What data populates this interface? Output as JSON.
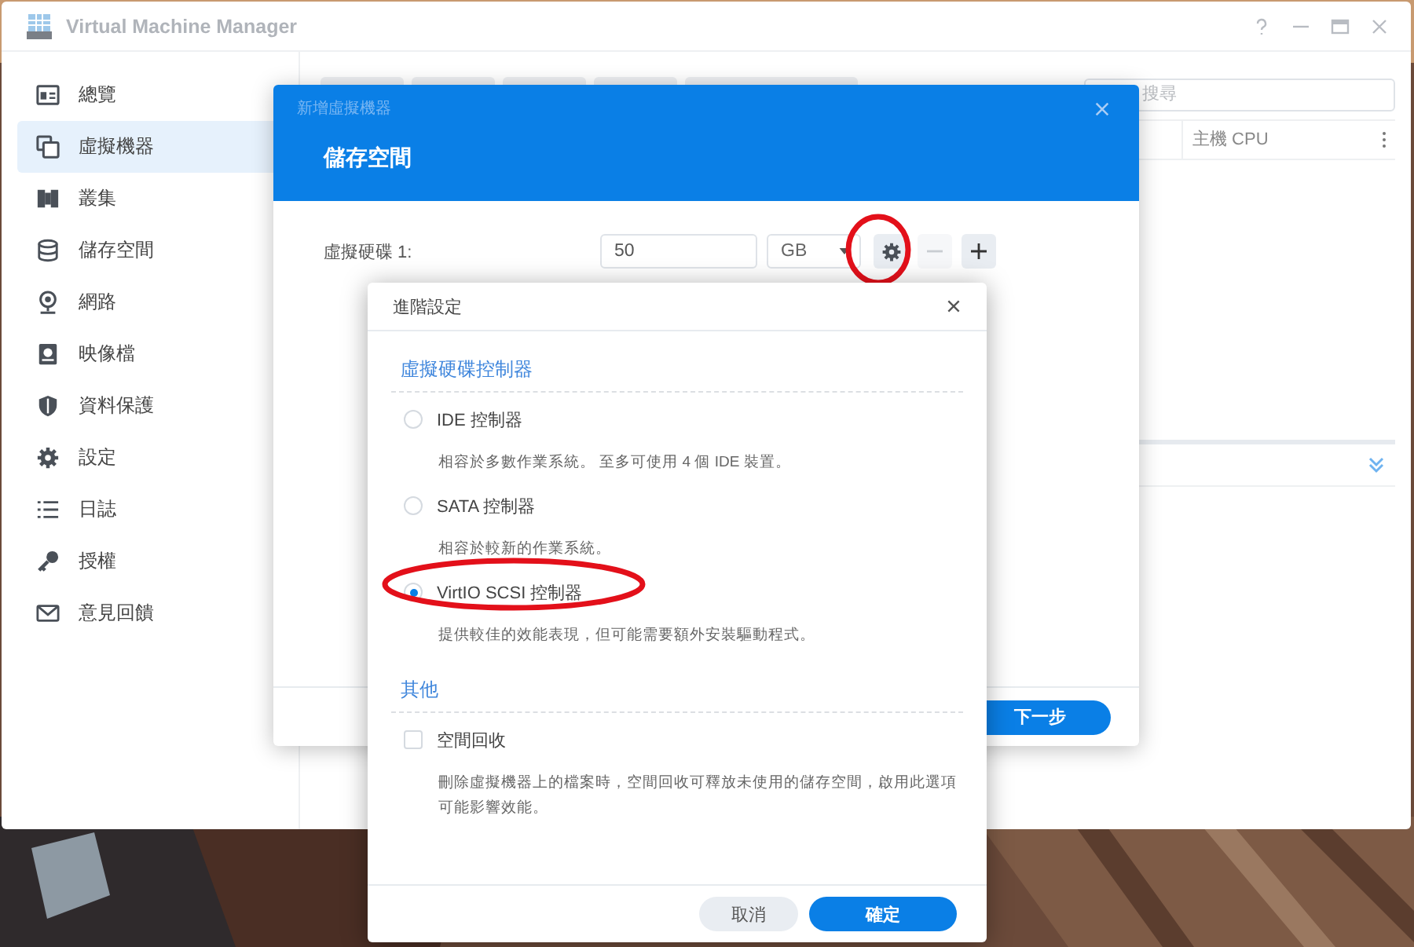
{
  "window": {
    "title": "Virtual Machine Manager"
  },
  "sidebar": {
    "items": [
      {
        "label": "總覽",
        "selected": false
      },
      {
        "label": "虛擬機器",
        "selected": true
      },
      {
        "label": "叢集",
        "selected": false
      },
      {
        "label": "儲存空間",
        "selected": false
      },
      {
        "label": "網路",
        "selected": false
      },
      {
        "label": "映像檔",
        "selected": false
      },
      {
        "label": "資料保護",
        "selected": false
      },
      {
        "label": "設定",
        "selected": false
      },
      {
        "label": "日誌",
        "selected": false
      },
      {
        "label": "授權",
        "selected": false
      },
      {
        "label": "意見回饋",
        "selected": false
      }
    ]
  },
  "search": {
    "placeholder": "搜尋"
  },
  "table": {
    "columns": [
      "主機 CPU"
    ]
  },
  "wizard": {
    "subtitle": "新增虛擬機器",
    "title": "儲存空間",
    "disk": {
      "label": "虛擬硬碟 1:",
      "size": "50",
      "unit": "GB",
      "remove_disabled": true
    },
    "next_button": "下一步"
  },
  "advanced": {
    "title": "進階設定",
    "sections": [
      {
        "heading": "虛擬硬碟控制器",
        "options": [
          {
            "kind": "radio",
            "label": "IDE 控制器",
            "description": "相容於多數作業系統。 至多可使用 4 個 IDE 裝置。",
            "selected": false
          },
          {
            "kind": "radio",
            "label": "SATA 控制器",
            "description": "相容於較新的作業系統。",
            "selected": false
          },
          {
            "kind": "radio",
            "label": "VirtIO SCSI 控制器",
            "description": "提供較佳的效能表現，但可能需要額外安裝驅動程式。",
            "selected": true
          }
        ]
      },
      {
        "heading": "其他",
        "options": [
          {
            "kind": "checkbox",
            "label": "空間回收",
            "description": "刪除虛擬機器上的檔案時，空間回收可釋放未使用的儲存空間，啟用此選項可能影響效能。",
            "checked": false
          }
        ]
      }
    ],
    "buttons": [
      {
        "label": "取消",
        "kind": "secondary"
      },
      {
        "label": "確定",
        "kind": "primary"
      }
    ]
  }
}
